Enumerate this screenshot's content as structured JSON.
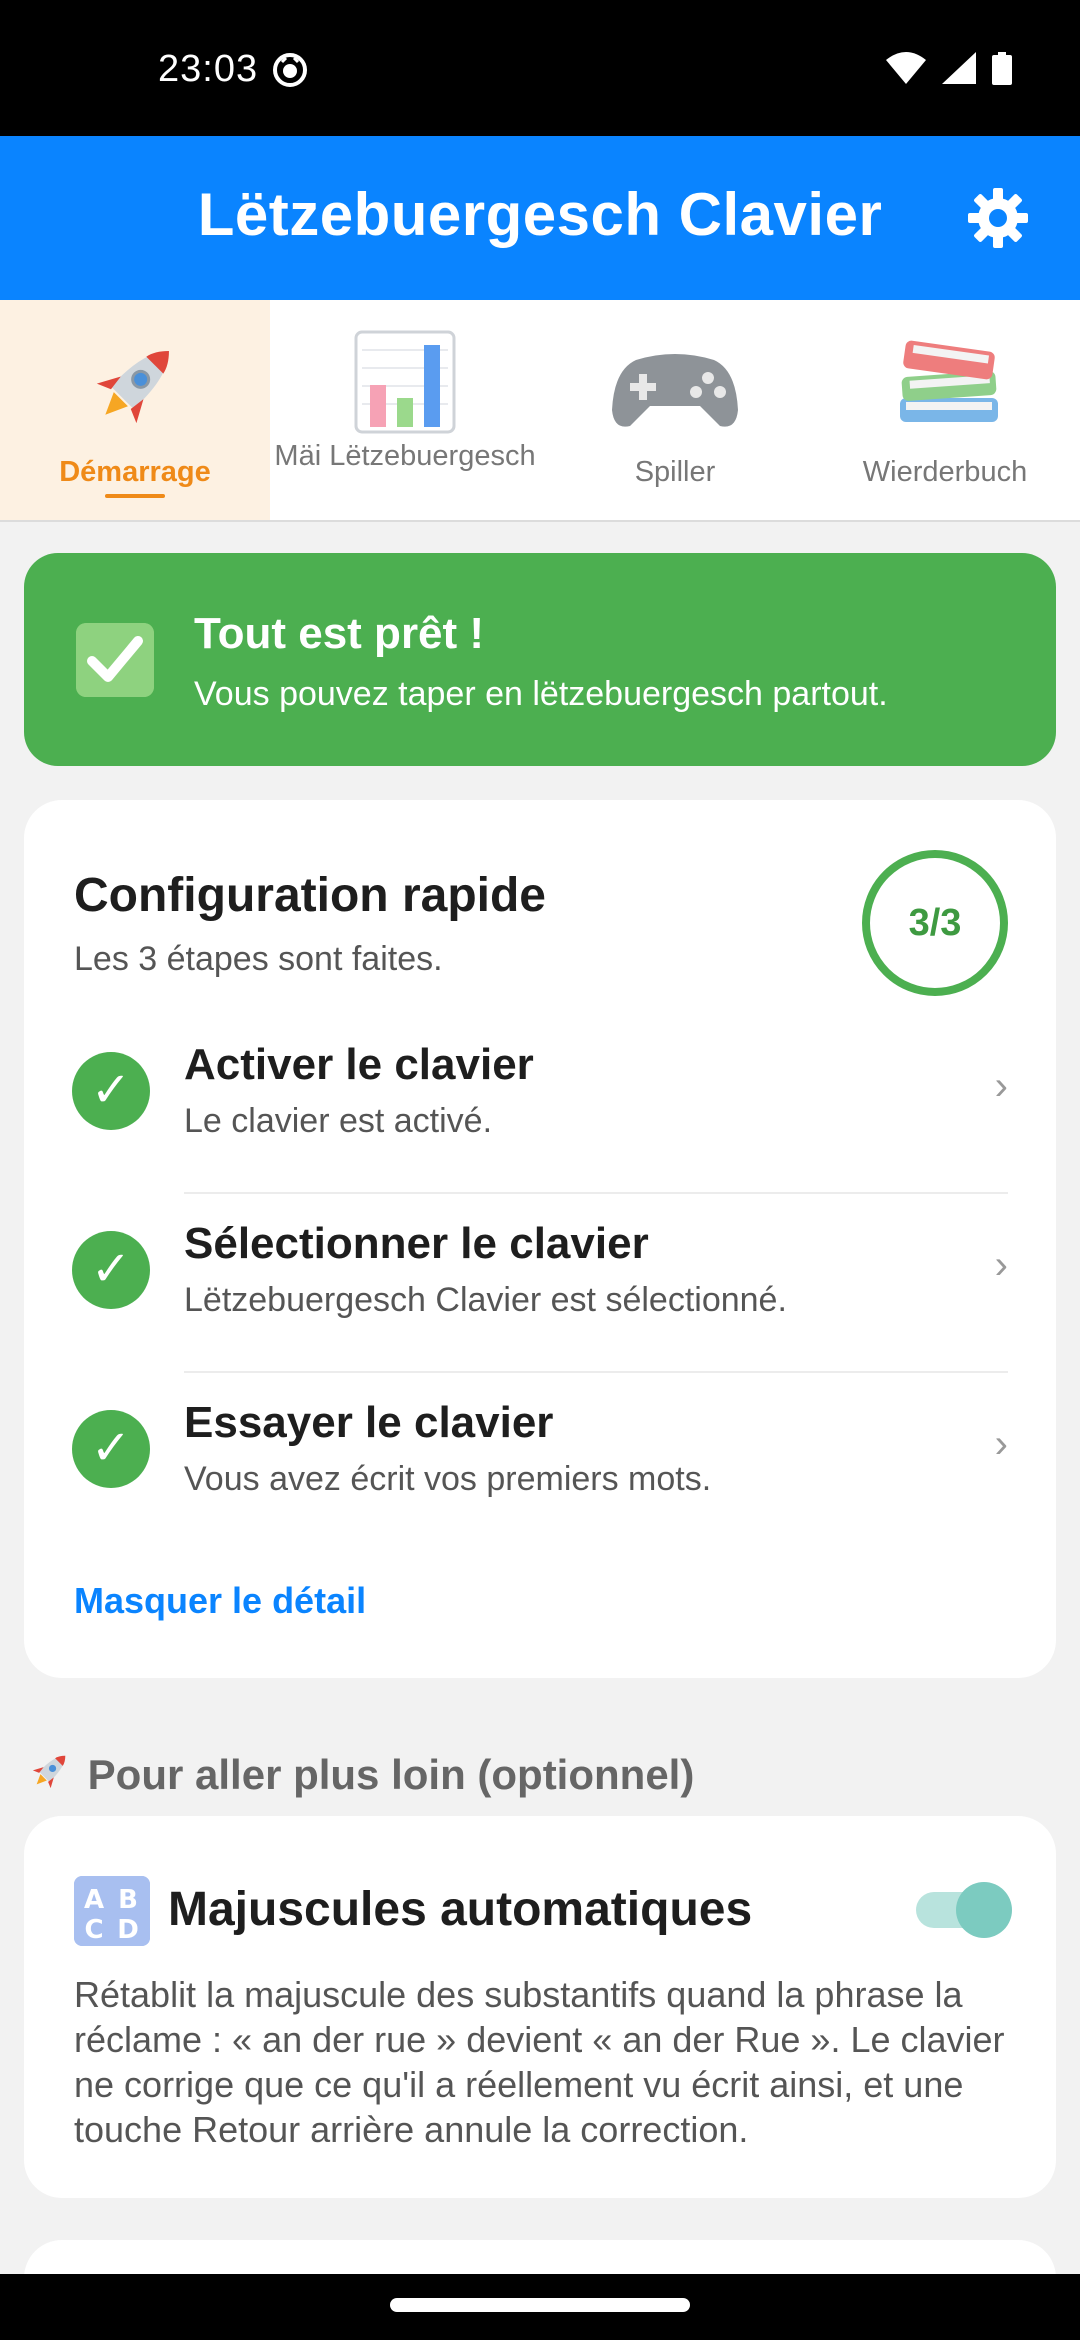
{
  "status_bar": {
    "time": "23:03"
  },
  "app_bar": {
    "title": "Lëtzebuergesch Clavier",
    "settings_icon": "gear-icon"
  },
  "tabs": [
    {
      "label": "Démarrage",
      "icon": "rocket-icon",
      "active": true
    },
    {
      "label": "Mäi Lëtzebuergesch",
      "icon": "bar-chart-icon",
      "active": false
    },
    {
      "label": "Spiller",
      "icon": "gamepad-icon",
      "active": false
    },
    {
      "label": "Wierderbuch",
      "icon": "books-icon",
      "active": false
    }
  ],
  "banner": {
    "title": "Tout est prêt !",
    "subtitle": "Vous pouvez taper en lëtzebuergesch partout.",
    "icon": "check-mark-icon",
    "color": "#4caf50"
  },
  "setup": {
    "title": "Configuration rapide",
    "subtitle": "Les 3 étapes sont faites.",
    "progress": "3/3",
    "steps": [
      {
        "title": "Activer le clavier",
        "description": "Le clavier est activé.",
        "done": true
      },
      {
        "title": "Sélectionner le clavier",
        "description": "Lëtzebuergesch Clavier est sélectionné.",
        "done": true
      },
      {
        "title": "Essayer le clavier",
        "description": "Vous avez écrit vos premiers mots.",
        "done": true
      }
    ],
    "toggle_link": "Masquer le détail"
  },
  "optional": {
    "section_title": "Pour aller plus loin (optionnel)",
    "section_icon": "rocket-icon",
    "auto_caps": {
      "title": "Majuscules automatiques",
      "icon": "abcd-icon",
      "enabled": true,
      "description": "Rétablit la majuscule des substantifs quand la phrase la réclame : « an der rue » devient « an der Rue ». Le clavier ne corrige que ce qu'il a réellement vu écrit ainsi, et une touche Retour arrière annule la correction."
    }
  },
  "colors": {
    "accent": "#0a84ff",
    "success": "#4caf50",
    "active_tab": "#ef8a18",
    "switch": "#7ccbc0"
  }
}
